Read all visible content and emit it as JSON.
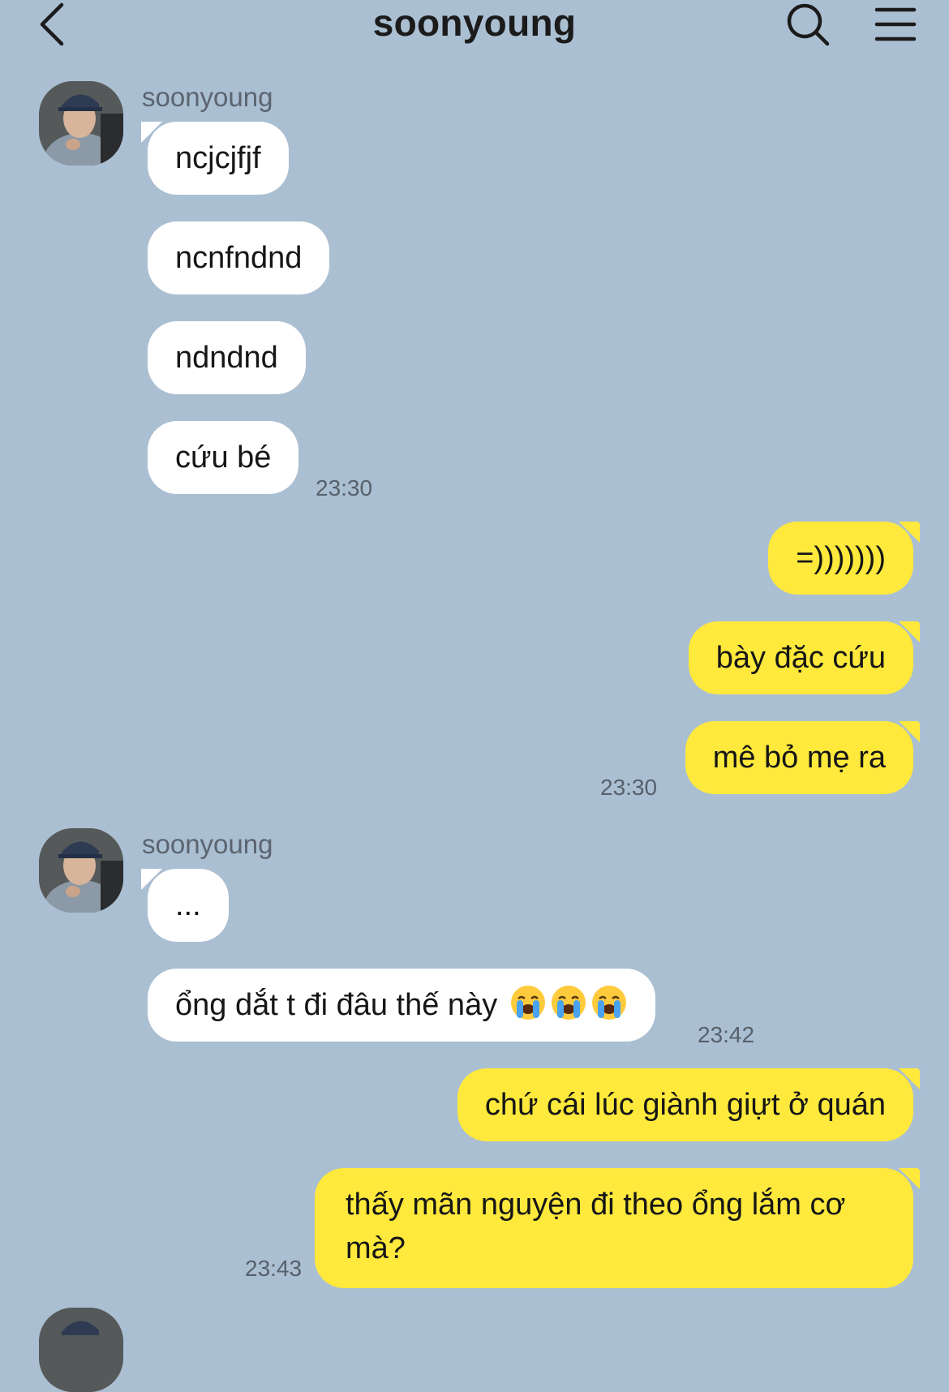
{
  "header": {
    "title": "soonyoung",
    "back_icon": "chevron-left-icon",
    "search_icon": "search-icon",
    "menu_icon": "hamburger-menu-icon"
  },
  "colors": {
    "background": "#abbfd2",
    "incoming_bubble": "#ffffff",
    "outgoing_bubble": "#fee93c"
  },
  "messages": {
    "group1": {
      "sender": "soonyoung",
      "m1": "ncjcjfjf",
      "m2": "ncnfndnd",
      "m3": "ndndnd",
      "m4": "cứu bé",
      "time": "23:30"
    },
    "group2": {
      "m1": "=)))))))",
      "m2": "bày đặc cứu",
      "m3": "mê bỏ mẹ ra",
      "time": "23:30"
    },
    "group3": {
      "sender": "soonyoung",
      "m1": "...",
      "m2": "ổng dắt t đi đâu thế này",
      "m2_emoji": "loudly-crying-face-emoji",
      "time": "23:42"
    },
    "group4": {
      "m1": "chứ cái lúc giành giựt ở quán",
      "m2_line1": "thấy mãn nguyện đi theo ổng lắm cơ",
      "m2_line2": "mà?",
      "time": "23:43"
    }
  }
}
